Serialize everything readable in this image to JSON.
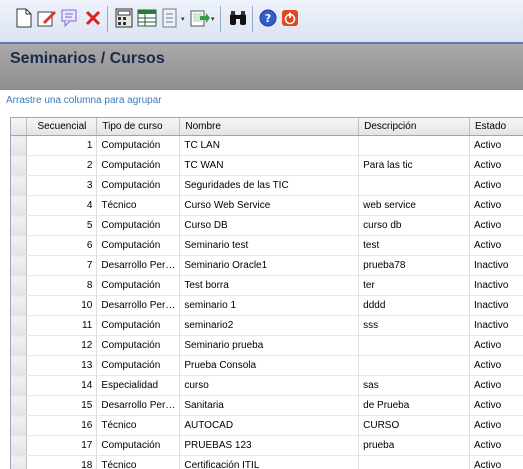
{
  "toolbar": {
    "buttons": [
      {
        "name": "new-icon",
        "color": "#ffffff"
      },
      {
        "name": "edit-icon",
        "color": "#d23a2a"
      },
      {
        "name": "notes-icon",
        "color": "#7d6bd6"
      },
      {
        "name": "delete-icon",
        "color": "#e02020"
      },
      {
        "name": "calculator-icon",
        "color": "#444"
      },
      {
        "name": "table-icon",
        "color": "#2a7a3a"
      },
      {
        "name": "report-icon",
        "color": "#6d7c92"
      },
      {
        "name": "export-icon",
        "color": "#3a9a48"
      },
      {
        "name": "binoculars-icon",
        "color": "#000"
      },
      {
        "name": "help-icon",
        "color": "#2f5fd0"
      },
      {
        "name": "power-icon",
        "color": "#e0481e"
      }
    ]
  },
  "page": {
    "title": "Seminarios / Cursos",
    "group_hint": "Arrastre una columna para agrupar"
  },
  "grid": {
    "columns": [
      "Secuencial",
      "Tipo de curso",
      "Nombre",
      "Descripción",
      "Estado"
    ],
    "rows": [
      [
        "1",
        "Computación",
        "TC LAN",
        "",
        "Activo"
      ],
      [
        "2",
        "Computación",
        "TC WAN",
        "Para las tic",
        "Activo"
      ],
      [
        "3",
        "Computación",
        "Seguridades de las TIC",
        "",
        "Activo"
      ],
      [
        "4",
        "Técnico",
        "Curso Web Service",
        "web service",
        "Activo"
      ],
      [
        "5",
        "Computación",
        "Curso DB",
        "curso db",
        "Activo"
      ],
      [
        "6",
        "Computación",
        "Seminario test",
        "test",
        "Activo"
      ],
      [
        "7",
        "Desarrollo Per…",
        "Seminario Oracle1",
        "prueba78",
        "Inactivo"
      ],
      [
        "8",
        "Computación",
        "Test borra",
        "ter",
        "Inactivo"
      ],
      [
        "10",
        "Desarrollo Per…",
        "seminario 1",
        "dddd",
        "Inactivo"
      ],
      [
        "11",
        "Computación",
        "seminario2",
        "sss",
        "Inactivo"
      ],
      [
        "12",
        "Computación",
        "Seminario prueba",
        "",
        "Activo"
      ],
      [
        "13",
        "Computación",
        "Prueba Consola",
        "",
        "Activo"
      ],
      [
        "14",
        "Especialidad",
        "curso",
        "sas",
        "Activo"
      ],
      [
        "15",
        "Desarrollo Per…",
        "Sanitaria",
        "de Prueba",
        "Activo"
      ],
      [
        "16",
        "Técnico",
        "AUTOCAD",
        "CURSO",
        "Activo"
      ],
      [
        "17",
        "Computación",
        "PRUEBAS 123",
        "prueba",
        "Activo"
      ],
      [
        "18",
        "Técnico",
        "Certificación ITIL",
        "",
        "Activo"
      ]
    ]
  }
}
